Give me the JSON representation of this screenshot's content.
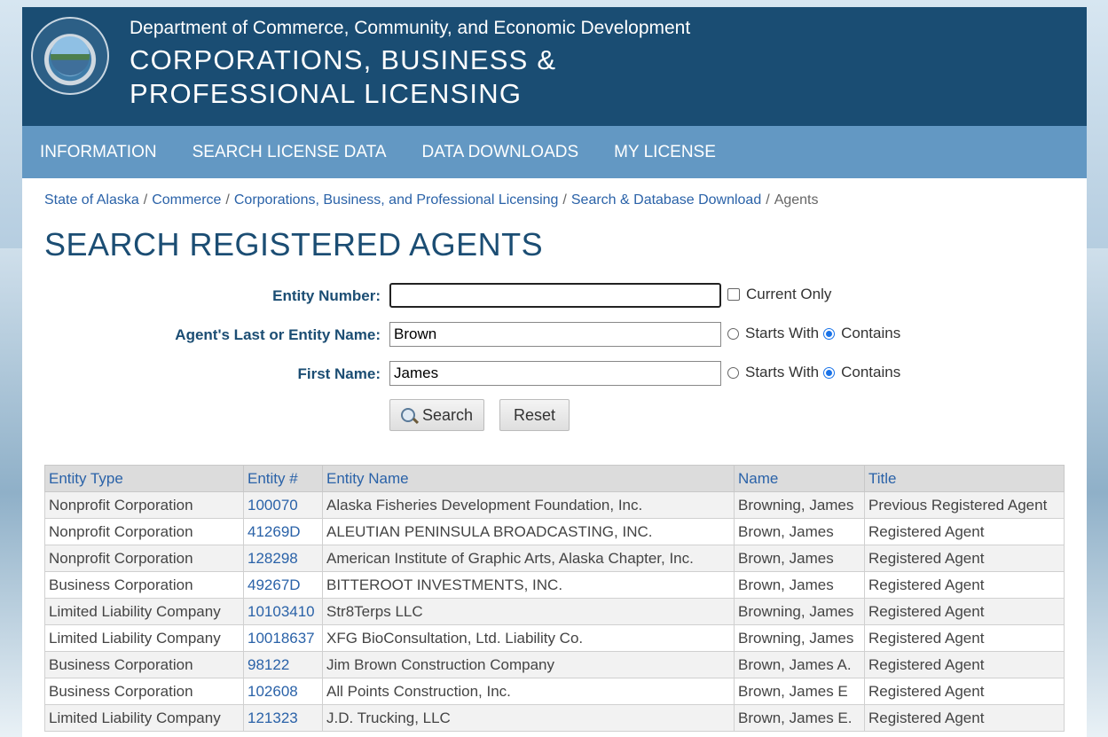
{
  "header": {
    "department": "Department of Commerce, Community, and Economic Development",
    "division": "CORPORATIONS, BUSINESS & PROFESSIONAL LICENSING"
  },
  "nav": [
    "INFORMATION",
    "SEARCH LICENSE DATA",
    "DATA DOWNLOADS",
    "MY LICENSE"
  ],
  "breadcrumb": {
    "links": [
      "State of Alaska",
      "Commerce",
      "Corporations, Business, and Professional Licensing",
      "Search & Database Download"
    ],
    "current": "Agents"
  },
  "page_title": "SEARCH REGISTERED AGENTS",
  "form": {
    "entity_number": {
      "label": "Entity Number:",
      "value": "",
      "option": "Current Only",
      "checked": false
    },
    "last_name": {
      "label": "Agent's Last or Entity Name:",
      "value": "Brown",
      "opt_starts": "Starts With",
      "opt_contains": "Contains",
      "selected": "Contains"
    },
    "first_name": {
      "label": "First Name:",
      "value": "James",
      "opt_starts": "Starts With",
      "opt_contains": "Contains",
      "selected": "Contains"
    },
    "search_label": "Search",
    "reset_label": "Reset"
  },
  "table": {
    "headers": [
      "Entity Type",
      "Entity #",
      "Entity Name",
      "Name",
      "Title"
    ],
    "rows": [
      [
        "Nonprofit Corporation",
        "100070",
        "Alaska Fisheries Development Foundation, Inc.",
        "Browning, James",
        "Previous Registered Agent"
      ],
      [
        "Nonprofit Corporation",
        "41269D",
        "ALEUTIAN PENINSULA BROADCASTING, INC.",
        "Brown, James",
        "Registered Agent"
      ],
      [
        "Nonprofit Corporation",
        "128298",
        "American Institute of Graphic Arts, Alaska Chapter, Inc.",
        "Brown, James",
        "Registered Agent"
      ],
      [
        "Business Corporation",
        "49267D",
        "BITTEROOT INVESTMENTS, INC.",
        "Brown, James",
        "Registered Agent"
      ],
      [
        "Limited Liability Company",
        "10103410",
        "Str8Terps LLC",
        "Browning, James",
        "Registered Agent"
      ],
      [
        "Limited Liability Company",
        "10018637",
        "XFG BioConsultation, Ltd. Liability Co.",
        "Browning, James",
        "Registered Agent"
      ],
      [
        "Business Corporation",
        "98122",
        "Jim Brown Construction Company",
        "Brown, James A.",
        "Registered Agent"
      ],
      [
        "Business Corporation",
        "102608",
        "All Points Construction, Inc.",
        "Brown, James E",
        "Registered Agent"
      ],
      [
        "Limited Liability Company",
        "121323",
        "J.D. Trucking, LLC",
        "Brown, James E.",
        "Registered Agent"
      ]
    ]
  }
}
